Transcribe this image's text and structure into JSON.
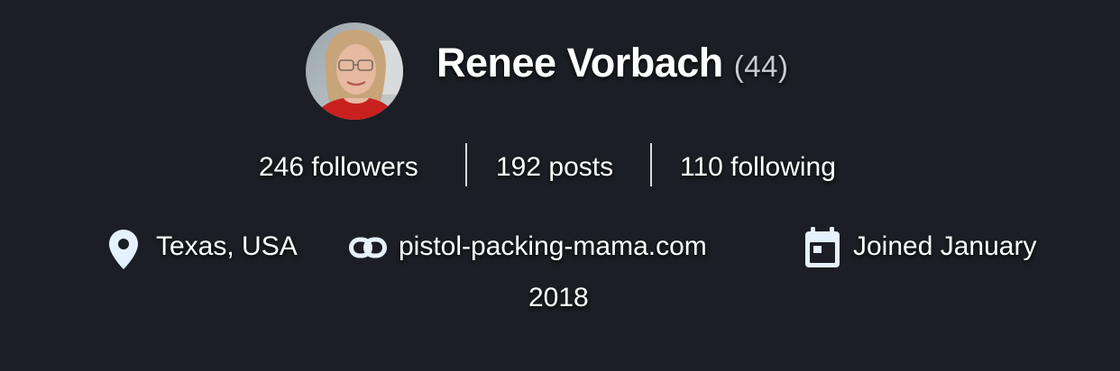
{
  "profile": {
    "name": "Renee Vorbach",
    "age": "(44)"
  },
  "stats": {
    "followers": "246 followers",
    "posts": "192 posts",
    "following": "110 following"
  },
  "meta": {
    "location": "Texas, USA",
    "website": "pistol-packing-mama.com",
    "joined_line1": "Joined January",
    "joined_line2": "2018"
  },
  "icons": {
    "location": "map-pin-icon",
    "website": "link-icon",
    "joined": "calendar-icon"
  },
  "colors": {
    "background": "#1b1e24",
    "text": "#ffffff",
    "icon": "#e6f1ff"
  }
}
